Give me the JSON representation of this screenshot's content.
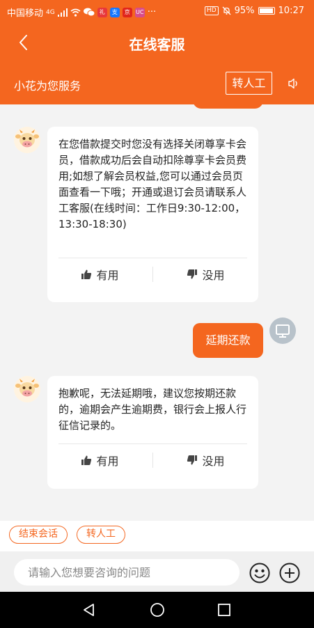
{
  "status_bar": {
    "carrier": "中国移动",
    "signal": "4G",
    "hd": "HD",
    "battery": "95%",
    "battery_level": 0.95,
    "time": "10:27",
    "app_icons": [
      {
        "name": "wechat-icon",
        "color": "#ffffff"
      },
      {
        "name": "app-icon-taobao",
        "color": "#e8373a",
        "label": "礼"
      },
      {
        "name": "app-icon-alipay",
        "color": "#1677ff",
        "label": "支"
      },
      {
        "name": "app-icon-jd",
        "color": "#e1251b",
        "label": "京"
      },
      {
        "name": "app-icon-misc",
        "color": "#d84d8b",
        "label": "UC"
      }
    ],
    "more": "···"
  },
  "header": {
    "title": "在线客服",
    "serve_label": "小花为您服务",
    "human_button": "转人工"
  },
  "chat": {
    "messages": [
      {
        "role": "bot",
        "text": "在您借款提交时您没有选择关闭尊享卡会员，借款成功后会自动扣除尊享卡会员费用;如想了解会员权益,您可以通过会员页面查看一下哦；开通或退订会员请联系人工客服(在线时间：工作日9:30-12:00，13:30-18:30)",
        "useful": "有用",
        "useless": "没用"
      },
      {
        "role": "user",
        "text": "延期还款"
      },
      {
        "role": "bot",
        "text": "抱歉呢，无法延期哦，建议您按期还款的，逾期会产生逾期费，银行会上报人行征信记录的。",
        "useful": "有用",
        "useless": "没用"
      }
    ]
  },
  "quick_actions": [
    "结束会话",
    "转人工"
  ],
  "input": {
    "placeholder": "请输入您想要咨询的问题"
  },
  "colors": {
    "brand": "#f4661f",
    "background": "#f3f3f3"
  }
}
